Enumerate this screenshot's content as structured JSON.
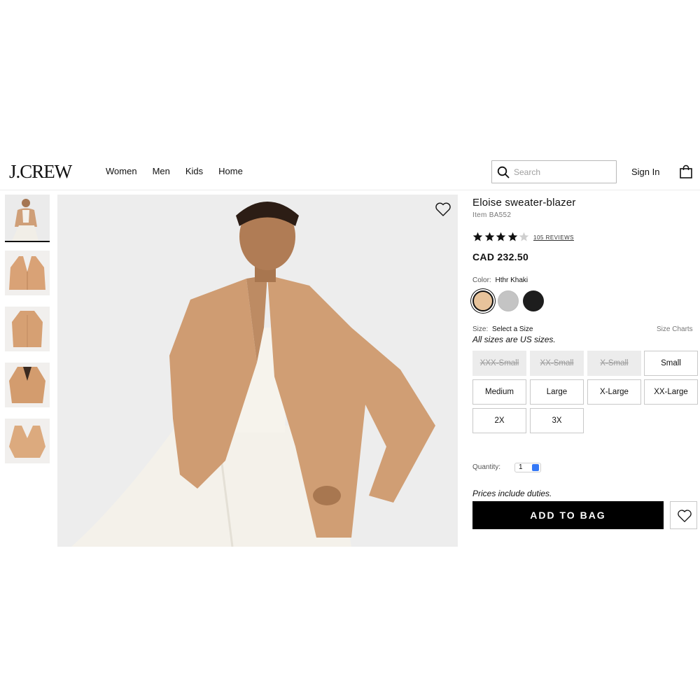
{
  "brand": {
    "logo": "J.CREW"
  },
  "nav": {
    "items": [
      "Women",
      "Men",
      "Kids",
      "Home"
    ]
  },
  "search": {
    "placeholder": "Search"
  },
  "header": {
    "sign_in": "Sign In"
  },
  "icons": {
    "search": "search-icon",
    "bag": "shopping-bag-icon",
    "wishlist": "heart-icon",
    "star": "star-icon"
  },
  "product": {
    "title": "Eloise sweater-blazer",
    "item_number": "Item BA552",
    "rating": 4,
    "rating_max": 5,
    "reviews_label": "105 REVIEWS",
    "price": "CAD 232.50",
    "color_label": "Color:",
    "color_selected": "Hthr Khaki",
    "colors": [
      {
        "name": "Hthr Khaki",
        "hex": "#e7c39b"
      },
      {
        "name": "Grey",
        "hex": "#c4c4c4"
      },
      {
        "name": "Black",
        "hex": "#1d1d1d"
      }
    ],
    "size_label": "Size:",
    "size_selected": "Select a Size",
    "size_charts": "Size Charts",
    "size_note": "All sizes are US sizes.",
    "sizes": [
      {
        "label": "XXX-Small",
        "available": false
      },
      {
        "label": "XX-Small",
        "available": false
      },
      {
        "label": "X-Small",
        "available": false
      },
      {
        "label": "Small",
        "available": true
      },
      {
        "label": "Medium",
        "available": true
      },
      {
        "label": "Large",
        "available": true
      },
      {
        "label": "X-Large",
        "available": true
      },
      {
        "label": "XX-Large",
        "available": true
      },
      {
        "label": "2X",
        "available": true
      },
      {
        "label": "3X",
        "available": true
      }
    ],
    "quantity_label": "Quantity:",
    "quantity_value": "1",
    "duties_note": "Prices include duties.",
    "add_to_bag": "ADD TO BAG"
  },
  "gallery": {
    "thumbnail_count": 5,
    "active_index": 0
  },
  "colors": {
    "primary_button": "#000000",
    "disabled_size_bg": "#ececec",
    "accent_blue": "#3478f6"
  }
}
